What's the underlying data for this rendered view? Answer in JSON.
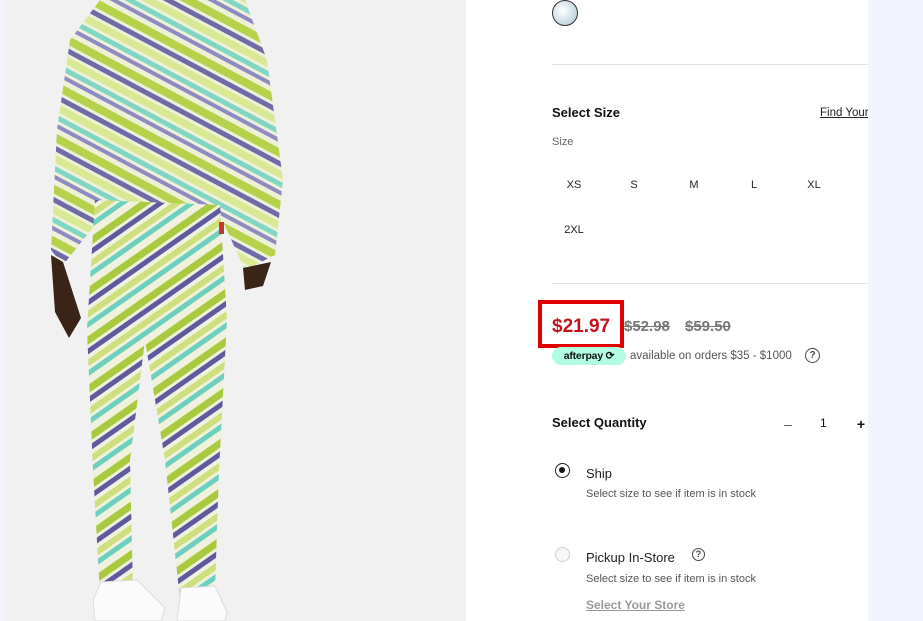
{
  "sizes": {
    "heading": "Select Size",
    "guide_link": "Find Your",
    "caption": "Size",
    "options": [
      "XS",
      "S",
      "M",
      "L",
      "XL",
      "2XL"
    ]
  },
  "price": {
    "sale": "$21.97",
    "original_1": "$52.98",
    "original_2": "$59.50",
    "highlight_color": "#e00000"
  },
  "afterpay": {
    "badge": "afterpay",
    "text": "available on orders $35 - $1000"
  },
  "quantity": {
    "heading": "Select Quantity",
    "minus": "–",
    "value": "1",
    "plus": "+"
  },
  "fulfillment": {
    "ship_label": "Ship",
    "ship_note": "Select size to see if item is in stock",
    "pickup_label": "Pickup In-Store",
    "pickup_note": "Select size to see if item is in stock",
    "store_link": "Select Your Store"
  },
  "icons": {
    "help": "?"
  }
}
